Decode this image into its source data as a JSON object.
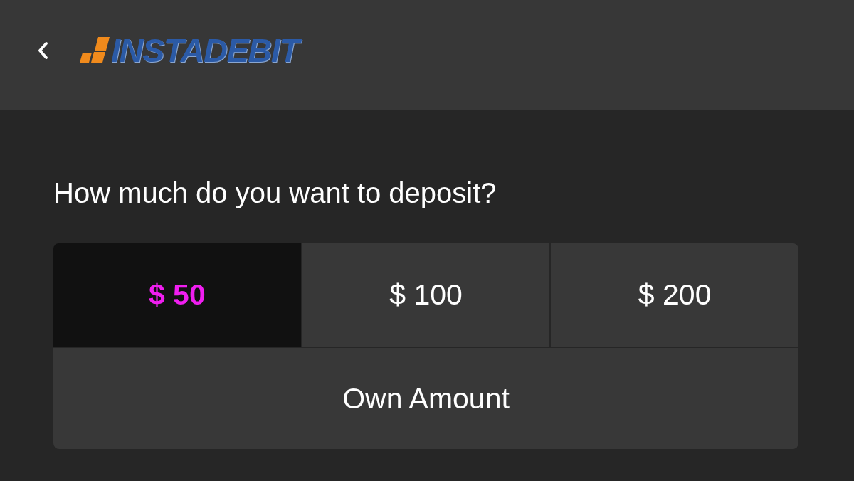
{
  "header": {
    "logo": {
      "wordmark": "INSTADEBIT"
    }
  },
  "question": "How much do you want to deposit?",
  "options": [
    {
      "kind": "preset",
      "label": "$ 50",
      "selected": true
    },
    {
      "kind": "preset",
      "label": "$ 100",
      "selected": false
    },
    {
      "kind": "preset",
      "label": "$ 200",
      "selected": false
    },
    {
      "kind": "custom",
      "label": "Own Amount",
      "selected": false
    }
  ]
}
